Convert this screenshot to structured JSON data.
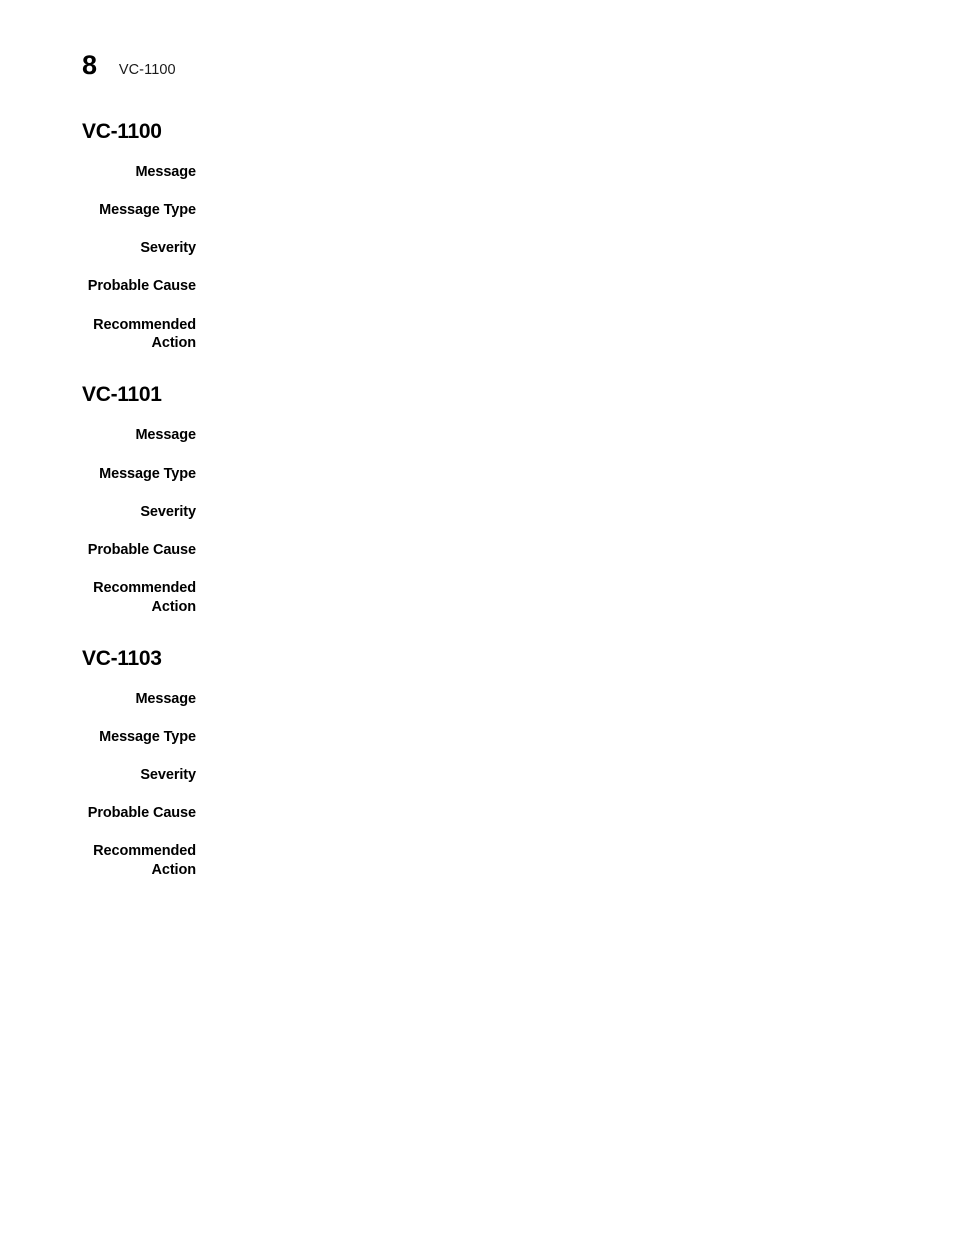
{
  "document": {
    "page_number": "8",
    "header_title": "VC-1100"
  },
  "field_labels": {
    "message": "Message",
    "message_type": "Message Type",
    "severity": "Severity",
    "probable_cause": "Probable Cause",
    "recommended_action": "Recommended\nAction"
  },
  "sections": [
    {
      "heading": "VC-1100",
      "fields": [
        {
          "label": "Message",
          "value": ""
        },
        {
          "label": "Message Type",
          "value": ""
        },
        {
          "label": "Severity",
          "value": ""
        },
        {
          "label": "Probable Cause",
          "value": ""
        },
        {
          "label": "Recommended\nAction",
          "value": ""
        }
      ]
    },
    {
      "heading": "VC-1101",
      "fields": [
        {
          "label": "Message",
          "value": ""
        },
        {
          "label": "Message Type",
          "value": ""
        },
        {
          "label": "Severity",
          "value": ""
        },
        {
          "label": "Probable Cause",
          "value": ""
        },
        {
          "label": "Recommended\nAction",
          "value": ""
        }
      ]
    },
    {
      "heading": "VC-1103",
      "fields": [
        {
          "label": "Message",
          "value": ""
        },
        {
          "label": "Message Type",
          "value": ""
        },
        {
          "label": "Severity",
          "value": ""
        },
        {
          "label": "Probable Cause",
          "value": ""
        },
        {
          "label": "Recommended\nAction",
          "value": ""
        }
      ]
    }
  ],
  "colors": {
    "page_background": "#ffffff",
    "text": "#000000",
    "header_text": "#1a1a1a"
  }
}
